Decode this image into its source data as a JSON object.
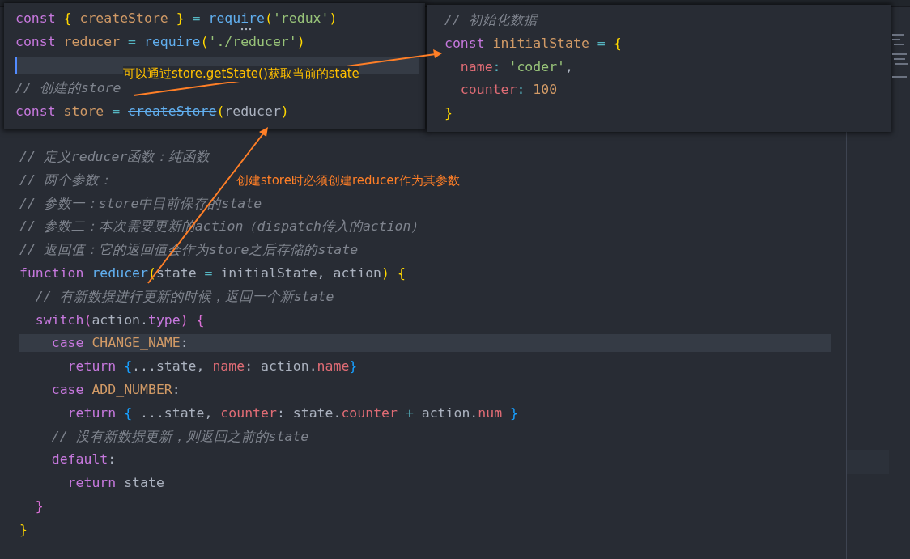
{
  "left_snippet": {
    "lines": [
      {
        "highlighted": false,
        "cursor": false,
        "tokens": [
          {
            "kind": "keyword",
            "text": "const "
          },
          {
            "kind": "bracket1",
            "text": "{ "
          },
          {
            "kind": "variable",
            "text": "createStore "
          },
          {
            "kind": "bracket1",
            "text": "} "
          },
          {
            "kind": "operator",
            "text": "= "
          },
          {
            "kind": "function",
            "text": "require"
          },
          {
            "kind": "bracket1",
            "text": "("
          },
          {
            "kind": "string",
            "text": "'redux'"
          },
          {
            "kind": "bracket1",
            "text": ")"
          }
        ]
      },
      {
        "highlighted": false,
        "cursor": false,
        "tokens": [
          {
            "kind": "keyword",
            "text": "const "
          },
          {
            "kind": "variable",
            "text": "reducer "
          },
          {
            "kind": "operator",
            "text": "= "
          },
          {
            "kind": "function",
            "text": "require"
          },
          {
            "kind": "bracket1",
            "text": "("
          },
          {
            "kind": "string",
            "text": "'./reducer'"
          },
          {
            "kind": "bracket1",
            "text": ")"
          }
        ]
      },
      {
        "highlighted": true,
        "cursor": true
      },
      {
        "highlighted": false,
        "cursor": false,
        "tokens": [
          {
            "kind": "comment",
            "text": "// 创建的store"
          }
        ]
      },
      {
        "highlighted": false,
        "cursor": false,
        "tokens": [
          {
            "kind": "keyword",
            "text": "const "
          },
          {
            "kind": "variable",
            "text": "store "
          },
          {
            "kind": "operator",
            "text": "= "
          },
          {
            "kind": "deprecated",
            "text": "createStore"
          },
          {
            "kind": "bracket1",
            "text": "("
          },
          {
            "kind": "plain",
            "text": "reducer"
          },
          {
            "kind": "bracket1",
            "text": ")"
          }
        ]
      }
    ]
  },
  "right_snippet": {
    "lines": [
      {
        "tokens": [
          {
            "kind": "comment",
            "text": "// 初始化数据"
          }
        ]
      },
      {
        "tokens": [
          {
            "kind": "keyword",
            "text": "const "
          },
          {
            "kind": "variable",
            "text": "initialState "
          },
          {
            "kind": "operator",
            "text": "= "
          },
          {
            "kind": "bracket1",
            "text": "{"
          }
        ]
      },
      {
        "tokens": [
          {
            "kind": "property",
            "text": "  name"
          },
          {
            "kind": "operator",
            "text": ": "
          },
          {
            "kind": "string",
            "text": "'coder'"
          },
          {
            "kind": "plain",
            "text": ","
          }
        ]
      },
      {
        "tokens": [
          {
            "kind": "property",
            "text": "  counter"
          },
          {
            "kind": "operator",
            "text": ": "
          },
          {
            "kind": "number",
            "text": "100"
          }
        ]
      },
      {
        "tokens": [
          {
            "kind": "bracket1",
            "text": "}"
          }
        ]
      }
    ]
  },
  "editor": {
    "lines": [
      {
        "highlighted": false,
        "tokens": [
          {
            "kind": "comment",
            "text": "// 定义reducer函数：纯函数"
          }
        ]
      },
      {
        "highlighted": false,
        "tokens": [
          {
            "kind": "comment",
            "text": "// 两个参数："
          }
        ]
      },
      {
        "highlighted": false,
        "tokens": [
          {
            "kind": "comment",
            "text": "// 参数一：store中目前保存的state"
          }
        ]
      },
      {
        "highlighted": false,
        "tokens": [
          {
            "kind": "comment",
            "text": "// 参数二：本次需要更新的action（dispatch传入的action）"
          }
        ]
      },
      {
        "highlighted": false,
        "tokens": [
          {
            "kind": "comment",
            "text": "// 返回值：它的返回值会作为store之后存储的state"
          }
        ]
      },
      {
        "highlighted": false,
        "tokens": [
          {
            "kind": "keyword",
            "text": "function "
          },
          {
            "kind": "function",
            "text": "reducer"
          },
          {
            "kind": "bracket1",
            "text": "("
          },
          {
            "kind": "plain",
            "text": "state "
          },
          {
            "kind": "operator",
            "text": "= "
          },
          {
            "kind": "plain",
            "text": "initialState, action"
          },
          {
            "kind": "bracket1",
            "text": ") {"
          }
        ]
      },
      {
        "highlighted": false,
        "tokens": [
          {
            "kind": "comment",
            "text": "  // 有新数据进行更新的时候，返回一个新state"
          }
        ]
      },
      {
        "highlighted": false,
        "tokens": [
          {
            "kind": "keyword",
            "text": "  switch"
          },
          {
            "kind": "bracket2",
            "text": "("
          },
          {
            "kind": "plain",
            "text": "action."
          },
          {
            "kind": "keyword",
            "text": "type"
          },
          {
            "kind": "bracket2",
            "text": ") {"
          }
        ]
      },
      {
        "highlighted": true,
        "tokens": [
          {
            "kind": "keyword",
            "text": "    case "
          },
          {
            "kind": "variable",
            "text": "CHANGE_NAME"
          },
          {
            "kind": "plain",
            "text": ":"
          }
        ]
      },
      {
        "highlighted": false,
        "tokens": [
          {
            "kind": "keyword",
            "text": "      return "
          },
          {
            "kind": "bracket3",
            "text": "{"
          },
          {
            "kind": "plain",
            "text": "...state, "
          },
          {
            "kind": "property",
            "text": "name"
          },
          {
            "kind": "plain",
            "text": ": action."
          },
          {
            "kind": "property",
            "text": "name"
          },
          {
            "kind": "bracket3",
            "text": "}"
          }
        ]
      },
      {
        "highlighted": false,
        "tokens": [
          {
            "kind": "keyword",
            "text": "    case "
          },
          {
            "kind": "variable",
            "text": "ADD_NUMBER"
          },
          {
            "kind": "plain",
            "text": ":"
          }
        ]
      },
      {
        "highlighted": false,
        "tokens": [
          {
            "kind": "keyword",
            "text": "      return "
          },
          {
            "kind": "bracket3",
            "text": "{ "
          },
          {
            "kind": "plain",
            "text": "...state, "
          },
          {
            "kind": "property",
            "text": "counter"
          },
          {
            "kind": "plain",
            "text": ": state."
          },
          {
            "kind": "property",
            "text": "counter "
          },
          {
            "kind": "operator",
            "text": "+ "
          },
          {
            "kind": "plain",
            "text": "action."
          },
          {
            "kind": "property",
            "text": "num "
          },
          {
            "kind": "bracket3",
            "text": "}"
          }
        ]
      },
      {
        "highlighted": false,
        "tokens": [
          {
            "kind": "comment",
            "text": "    // 没有新数据更新，则返回之前的state"
          }
        ]
      },
      {
        "highlighted": false,
        "tokens": [
          {
            "kind": "keyword",
            "text": "    default"
          },
          {
            "kind": "plain",
            "text": ":"
          }
        ]
      },
      {
        "highlighted": false,
        "tokens": [
          {
            "kind": "keyword",
            "text": "      return "
          },
          {
            "kind": "plain",
            "text": "state"
          }
        ]
      },
      {
        "highlighted": false,
        "tokens": [
          {
            "kind": "bracket2",
            "text": "  }"
          }
        ]
      },
      {
        "highlighted": false,
        "tokens": [
          {
            "kind": "bracket1",
            "text": "}"
          }
        ]
      }
    ]
  },
  "annotations": [
    {
      "kind": "note",
      "text": "可以通过store.getState()获取当前的state",
      "color": "#ffc000"
    },
    {
      "kind": "note",
      "text": "创建store时必须创建reducer作为其参数",
      "color": "#ff7f27"
    }
  ]
}
